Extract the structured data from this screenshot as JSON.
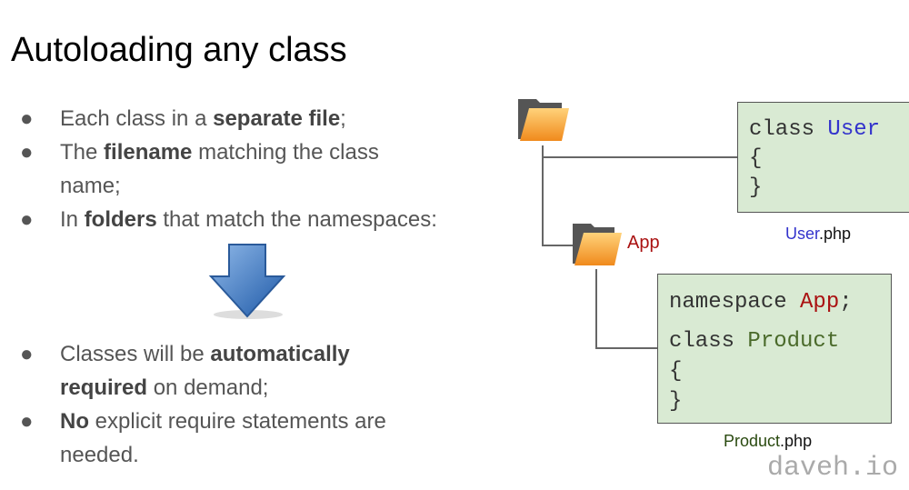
{
  "title": "Autoloading any class",
  "bullets_top": [
    {
      "parts": [
        "Each class in a ",
        "separate file",
        ";"
      ]
    },
    {
      "parts": [
        "The ",
        "filename",
        " matching the class name;"
      ]
    },
    {
      "parts": [
        "In ",
        "folders",
        " that match the namespaces:"
      ]
    }
  ],
  "bullets_bottom": [
    {
      "parts": [
        "Classes will be ",
        "automatically required",
        " on demand;"
      ]
    },
    {
      "parts": [
        "",
        "No",
        " explicit require statements are needed."
      ]
    }
  ],
  "bullet_char": "●",
  "diagram": {
    "folder_app_label": "App",
    "user_code": {
      "kw": "class",
      "name": "User",
      "open": "{",
      "close": "}"
    },
    "user_file": {
      "name": "User",
      "ext": ".php"
    },
    "product_code": {
      "ns_kw": "namespace",
      "ns": "App",
      "semi": ";",
      "kw": "class",
      "name": "Product",
      "open": "{",
      "close": "}"
    },
    "product_file": {
      "name": "Product",
      "ext": ".php"
    }
  },
  "brand": "daveh.io",
  "colors": {
    "user": "#3333cc",
    "app": "#aa1111",
    "product": "#4a6a2a",
    "box": "#d9ead3"
  }
}
